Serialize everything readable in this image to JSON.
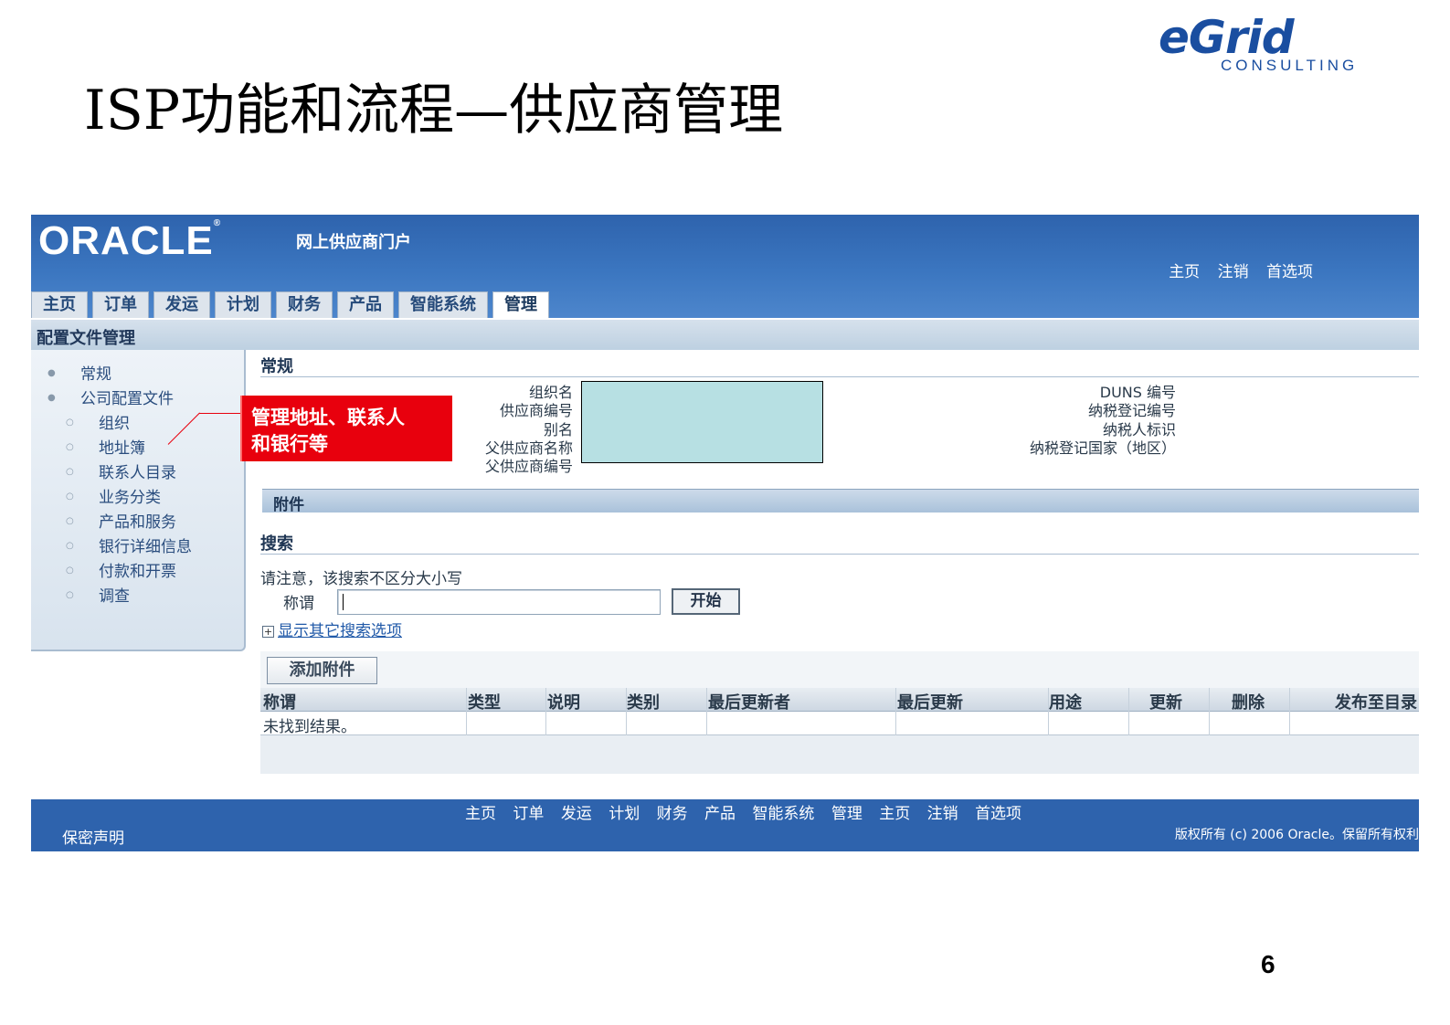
{
  "slide": {
    "title": "ISP功能和流程—供应商管理",
    "logo_main": "eGrid",
    "logo_sub": "CONSULTING",
    "page_number": "6"
  },
  "app": {
    "brand": "ORACLE",
    "portal_name": "网上供应商门户",
    "global_links": [
      "主页",
      "注销",
      "首选项"
    ],
    "tabs": [
      "主页",
      "订单",
      "发运",
      "计划",
      "财务",
      "产品",
      "智能系统",
      "管理"
    ],
    "active_tab": "管理",
    "subtitle": "配置文件管理"
  },
  "sidebar": {
    "items": [
      {
        "label": "常规",
        "level": 1
      },
      {
        "label": "公司配置文件",
        "level": 1
      },
      {
        "label": "组织",
        "level": 2
      },
      {
        "label": "地址簿",
        "level": 2
      },
      {
        "label": "联系人目录",
        "level": 2
      },
      {
        "label": "业务分类",
        "level": 2
      },
      {
        "label": "产品和服务",
        "level": 2
      },
      {
        "label": "银行详细信息",
        "level": 2
      },
      {
        "label": "付款和开票",
        "level": 2
      },
      {
        "label": "调查",
        "level": 2
      }
    ]
  },
  "general": {
    "header": "常规",
    "left_labels": [
      "组织名",
      "供应商编号",
      "别名",
      "父供应商名称",
      "父供应商编号"
    ],
    "right_labels": [
      "DUNS 编号",
      "纳税登记编号",
      "纳税人标识",
      "纳税登记国家（地区）"
    ]
  },
  "attachments": {
    "header": "附件",
    "search_header": "搜索",
    "note": "请注意，该搜索不区分大小写",
    "search_label": "称谓",
    "search_value": "",
    "go_button": "开始",
    "more_options": "显示其它搜索选项",
    "add_button": "添加附件",
    "columns": [
      "称谓",
      "类型",
      "说明",
      "类别",
      "最后更新者",
      "最后更新",
      "用途",
      "更新",
      "删除",
      "发布至目录"
    ],
    "empty_message": "未找到结果。"
  },
  "footer": {
    "links": [
      "主页",
      "订单",
      "发运",
      "计划",
      "财务",
      "产品",
      "智能系统",
      "管理",
      "主页",
      "注销",
      "首选项"
    ],
    "privacy": "保密声明",
    "copyright": "版权所有 (c) 2006 Oracle。保留所有权利"
  },
  "callout": {
    "line1": "管理地址、联系人",
    "line2": "和银行等"
  },
  "colors": {
    "banner": "#2e63ad",
    "callout": "#e8000d",
    "teal_highlight": "#b7e0e3"
  }
}
